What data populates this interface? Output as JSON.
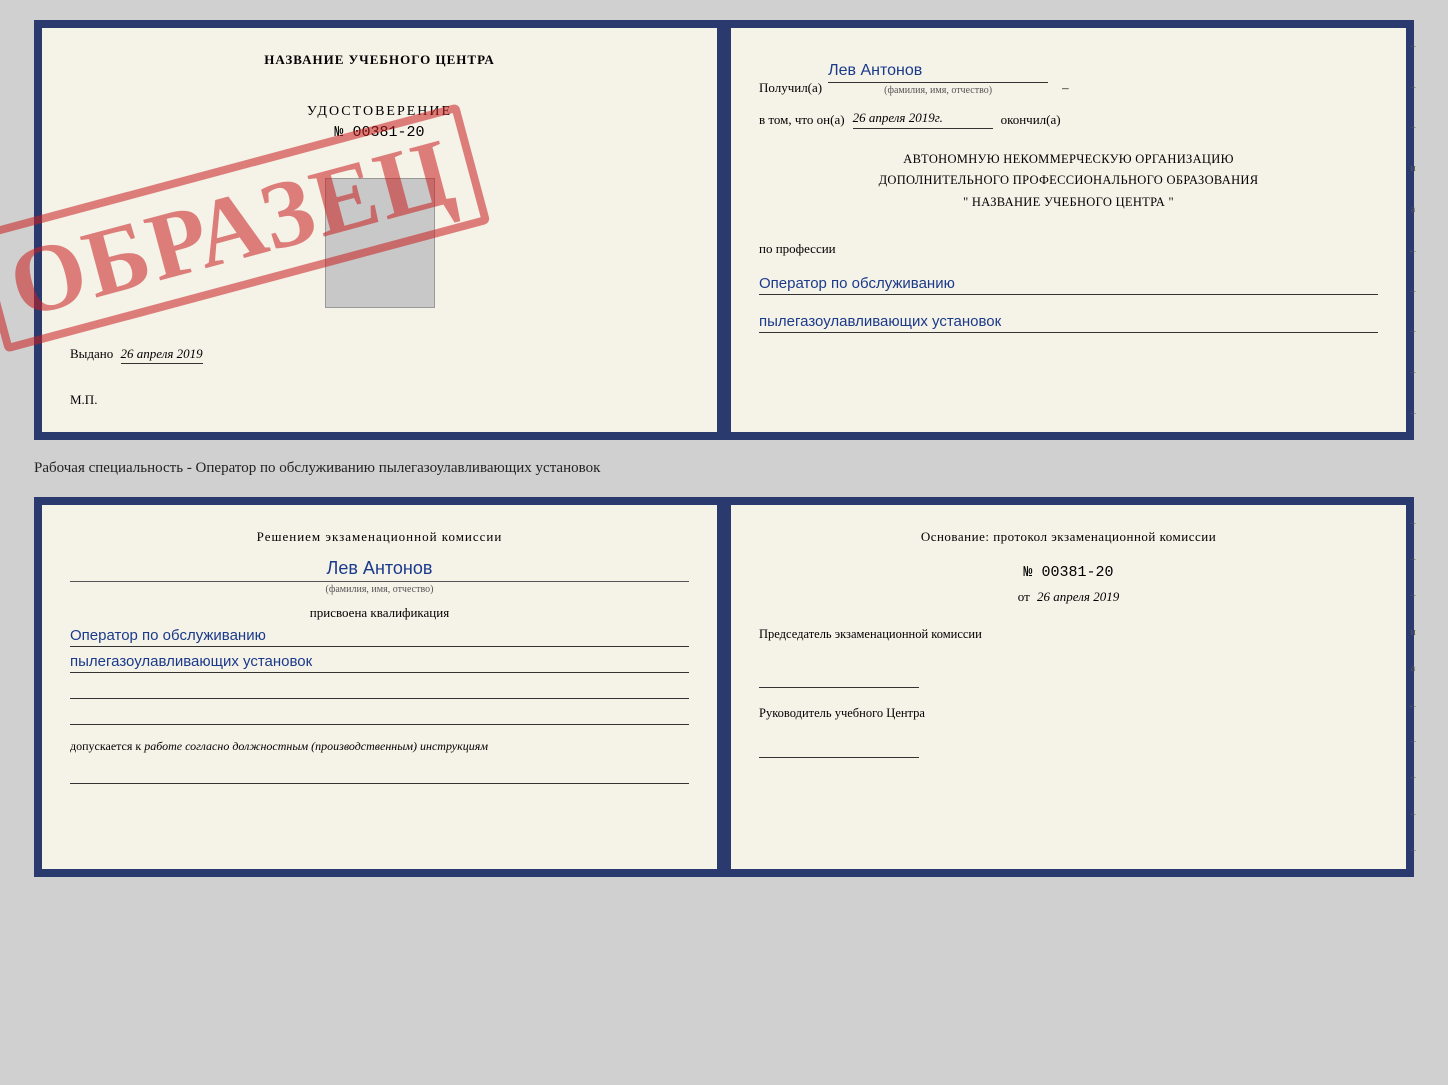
{
  "top_spread": {
    "left": {
      "school_name": "НАЗВАНИЕ УЧЕБНОГО ЦЕНТРА",
      "udostoverenie_title": "УДОСТОВЕРЕНИЕ",
      "udostoverenie_number": "№ 00381-20",
      "vydano_label": "Выдано",
      "vydano_date": "26 апреля 2019",
      "mp_label": "М.П.",
      "obrazets": "ОБРАЗЕЦ"
    },
    "right": {
      "poluchil_label": "Получил(а)",
      "poluchil_name": "Лев Антонов",
      "fio_hint": "(фамилия, имя, отчество)",
      "vtom_label": "в том, что он(а)",
      "date_value": "26 апреля 2019г.",
      "okonchil_label": "окончил(а)",
      "org_line1": "АВТОНОМНУЮ НЕКОММЕРЧЕСКУЮ ОРГАНИЗАЦИЮ",
      "org_line2": "ДОПОЛНИТЕЛЬНОГО ПРОФЕССИОНАЛЬНОГО ОБРАЗОВАНИЯ",
      "org_line3": "\"  НАЗВАНИЕ УЧЕБНОГО ЦЕНТРА  \"",
      "po_professii_label": "по профессии",
      "profession_line1": "Оператор по обслуживанию",
      "profession_line2": "пылегазоулавливающих установок",
      "side_marks": [
        "–",
        "–",
        "–",
        "и",
        "а",
        "←",
        "–",
        "–",
        "–",
        "–"
      ]
    }
  },
  "subtitle": "Рабочая специальность - Оператор по обслуживанию пылегазоулавливающих установок",
  "bottom_spread": {
    "left": {
      "resolution_title": "Решением экзаменационной комиссии",
      "person_name": "Лев Антонов",
      "fio_hint": "(фамилия, имя, отчество)",
      "prisvoena_label": "присвоена квалификация",
      "qualification_line1": "Оператор по обслуживанию",
      "qualification_line2": "пылегазоулавливающих установок",
      "dopuskaetsya_label": "допускается к",
      "dopuskaetsya_italic": "работе согласно должностным (производственным) инструкциям"
    },
    "right": {
      "osnovanie_label": "Основание: протокол экзаменационной комиссии",
      "protocol_number": "№  00381-20",
      "ot_label": "от",
      "ot_date": "26 апреля 2019",
      "chairman_label": "Председатель экзаменационной комиссии",
      "rukovoditel_label": "Руководитель учебного Центра",
      "side_marks": [
        "–",
        "–",
        "–",
        "и",
        "а",
        "←",
        "–",
        "–",
        "–",
        "–"
      ]
    }
  }
}
